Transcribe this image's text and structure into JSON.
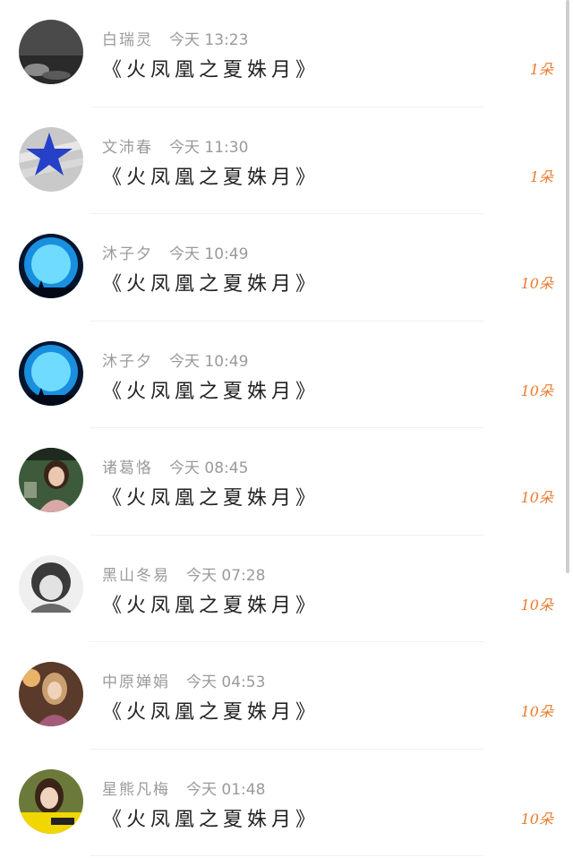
{
  "records": [
    {
      "name": "白瑞灵",
      "time": "今天 13:23",
      "gift": "《火凤凰之夏姝月》",
      "count": "1朵",
      "avatar": "avatar-dark-photo-icon"
    },
    {
      "name": "文沛春",
      "time": "今天 11:30",
      "gift": "《火凤凰之夏姝月》",
      "count": "1朵",
      "avatar": "avatar-blue-star-icon"
    },
    {
      "name": "沐子夕",
      "time": "今天 10:49",
      "gift": "《火凤凰之夏姝月》",
      "count": "10朵",
      "avatar": "avatar-blue-moon-icon"
    },
    {
      "name": "沐子夕",
      "time": "今天 10:49",
      "gift": "《火凤凰之夏姝月》",
      "count": "10朵",
      "avatar": "avatar-blue-moon-icon"
    },
    {
      "name": "诸葛恪",
      "time": "今天 08:45",
      "gift": "《火凤凰之夏姝月》",
      "count": "10朵",
      "avatar": "avatar-girl-photo-icon"
    },
    {
      "name": "黑山冬易",
      "time": "今天 07:28",
      "gift": "《火凤凰之夏姝月》",
      "count": "10朵",
      "avatar": "avatar-bw-girl-icon"
    },
    {
      "name": "中原婵娟",
      "time": "今天 04:53",
      "gift": "《火凤凰之夏姝月》",
      "count": "10朵",
      "avatar": "avatar-warm-photo-icon"
    },
    {
      "name": "星熊凡梅",
      "time": "今天 01:48",
      "gift": "《火凤凰之夏姝月》",
      "count": "10朵",
      "avatar": "avatar-yellow-banner-icon"
    }
  ],
  "colors": {
    "count": "#ec7b2e",
    "meta": "#9a9a9a",
    "gift": "#222222"
  }
}
